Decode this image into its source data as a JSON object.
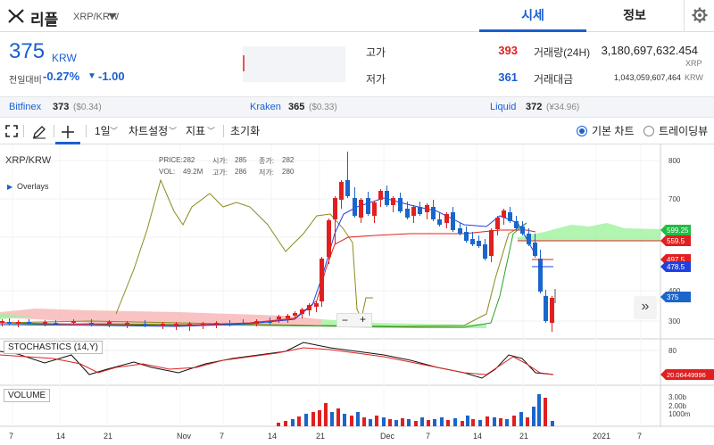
{
  "header": {
    "coin_name": "리플",
    "pair": "XRP/KRW",
    "tabs": [
      {
        "label": "시세",
        "active": true
      },
      {
        "label": "정보",
        "active": false
      }
    ]
  },
  "summary": {
    "price": "375",
    "unit": "KRW",
    "change_label": "전일대비",
    "change_pct": "-0.27%",
    "change_arrow": "▼",
    "change_val": "-1.00",
    "high_label": "고가",
    "high": "393",
    "low_label": "저가",
    "low": "361",
    "volume_label": "거래량(24H)",
    "volume": "3,180,697,632.454",
    "volume_unit": "XRP",
    "amount_label": "거래대금",
    "amount": "1,043,059,607,464",
    "amount_unit": "KRW"
  },
  "exchanges": [
    {
      "name": "Bitfinex",
      "value": "373",
      "sub": "($0.34)"
    },
    {
      "name": "Kraken",
      "value": "365",
      "sub": "($0.33)"
    },
    {
      "name": "Liquid",
      "value": "372",
      "sub": "(¥34.96)"
    }
  ],
  "toolbar": {
    "interval": "1일",
    "chart_settings": "차트설정",
    "indicators": "지표",
    "reset": "초기화",
    "basic_chart": "기본 차트",
    "tradingview": "트레이딩뷰"
  },
  "chart": {
    "symbol": "XRP/KRW",
    "overlays": "Overlays",
    "ohlc": {
      "price_label": "PRICE:",
      "price": "282",
      "open_label": "시가:",
      "open": "285",
      "close_label": "종가:",
      "close": "282",
      "vol_label": "VOL:",
      "vol": "49.2M",
      "high_label": "고가:",
      "high": "286",
      "low_label": "저가:",
      "low": "280"
    },
    "stochastics_label": "STOCHASTICS (14,Y)",
    "volume_label": "VOLUME",
    "zoom_minus": "−",
    "zoom_plus": "+",
    "scroll_icon": "»",
    "price_ticks": [
      "800",
      "700",
      "600",
      "400",
      "300"
    ],
    "stoch_tick": "80",
    "vol_ticks": [
      "3.00b",
      "2.00b",
      "1000m"
    ],
    "price_badges": [
      {
        "label": "599.25",
        "color": "#22bb44"
      },
      {
        "label": "559.5",
        "color": "#e02020"
      },
      {
        "label": "497.5",
        "color": "#e02020"
      },
      {
        "label": "478.5",
        "color": "#2040e0"
      },
      {
        "label": "375",
        "color": "#1a66cc"
      }
    ],
    "stoch_badge": {
      "label": "20.06449996",
      "color": "#e02020"
    },
    "x_ticks": [
      "7",
      "14",
      "21",
      "Nov",
      "7",
      "14",
      "21",
      "Dec",
      "7",
      "14",
      "21",
      "2021",
      "7"
    ]
  },
  "colors": {
    "accent": "#1a5fd0",
    "up": "#e02020",
    "down": "#1a66cc"
  }
}
